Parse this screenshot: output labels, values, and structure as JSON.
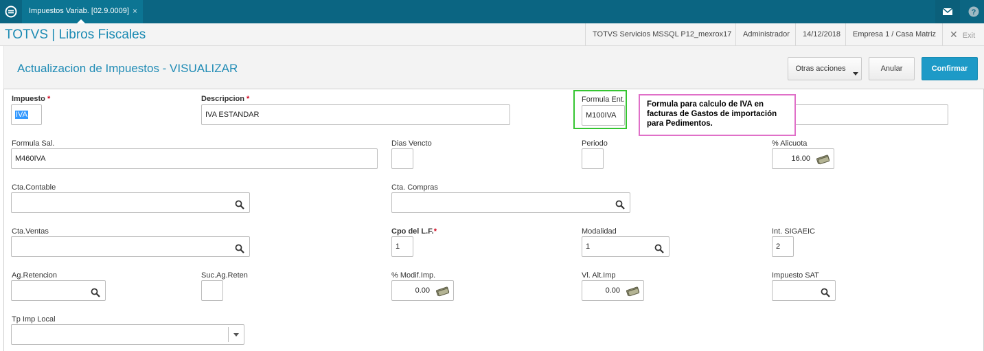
{
  "topbar": {
    "tab_title": "Impuestos Variab. [02.9.0009]",
    "tab_close": "×",
    "icons": {
      "logo": "totvs-logo-icon",
      "mail": "mail-icon",
      "help": "help-icon"
    }
  },
  "header": {
    "brand": "TOTVS | Libros Fiscales",
    "server": "TOTVS Servicios MSSQL P12_mexrox17",
    "user": "Administrador",
    "date": "14/12/2018",
    "company": "Empresa 1 / Casa Matriz",
    "exit_label": "Exit"
  },
  "page": {
    "title": "Actualizacion de Impuestos - VISUALIZAR",
    "buttons": {
      "other_actions": "Otras acciones",
      "cancel": "Anular",
      "confirm": "Confirmar"
    }
  },
  "form": {
    "impuesto": {
      "label": "Impuesto",
      "required": "*",
      "value": "IVA"
    },
    "descripcion": {
      "label": "Descripcion",
      "required": "*",
      "value": "IVA ESTANDAR"
    },
    "formula_ent": {
      "label": "Formula Ent.",
      "value": "M100IVA"
    },
    "formula_sal": {
      "label": "Formula Sal.",
      "value": "M460IVA"
    },
    "dias_vencto": {
      "label": "Dias Vencto",
      "value": ""
    },
    "periodo": {
      "label": "Periodo",
      "value": ""
    },
    "alicuota": {
      "label": "% Alicuota",
      "value": "16.00"
    },
    "cta_contable": {
      "label": "Cta.Contable",
      "value": ""
    },
    "cta_compras": {
      "label": "Cta. Compras",
      "value": ""
    },
    "cta_ventas": {
      "label": "Cta.Ventas",
      "value": ""
    },
    "cpo_lf": {
      "label": "Cpo del L.F.",
      "required": "*",
      "value": "1"
    },
    "modalidad": {
      "label": "Modalidad",
      "value": "1"
    },
    "int_sigaeic": {
      "label": "Int. SIGAEIC",
      "value": "2"
    },
    "ag_retencion": {
      "label": "Ag.Retencion",
      "value": ""
    },
    "suc_ag_reten": {
      "label": "Suc.Ag.Reten",
      "value": ""
    },
    "modif_imp": {
      "label": "% Modif.Imp.",
      "value": "0.00"
    },
    "vl_alt_imp": {
      "label": "Vl. Alt.Imp",
      "value": "0.00"
    },
    "impuesto_sat": {
      "label": "Impuesto SAT",
      "value": ""
    },
    "tp_imp_local": {
      "label": "Tp Imp Local",
      "value": ""
    }
  },
  "annotation": {
    "text": "Formula para calculo de IVA en facturas de Gastos de importación para Pedimentos.",
    "highlight_color": "#34c530",
    "note_border_color": "#e070c8"
  },
  "colors": {
    "topbar": "#0b6582",
    "brand": "#1a8ab3",
    "primary_button": "#1d9ac7"
  }
}
